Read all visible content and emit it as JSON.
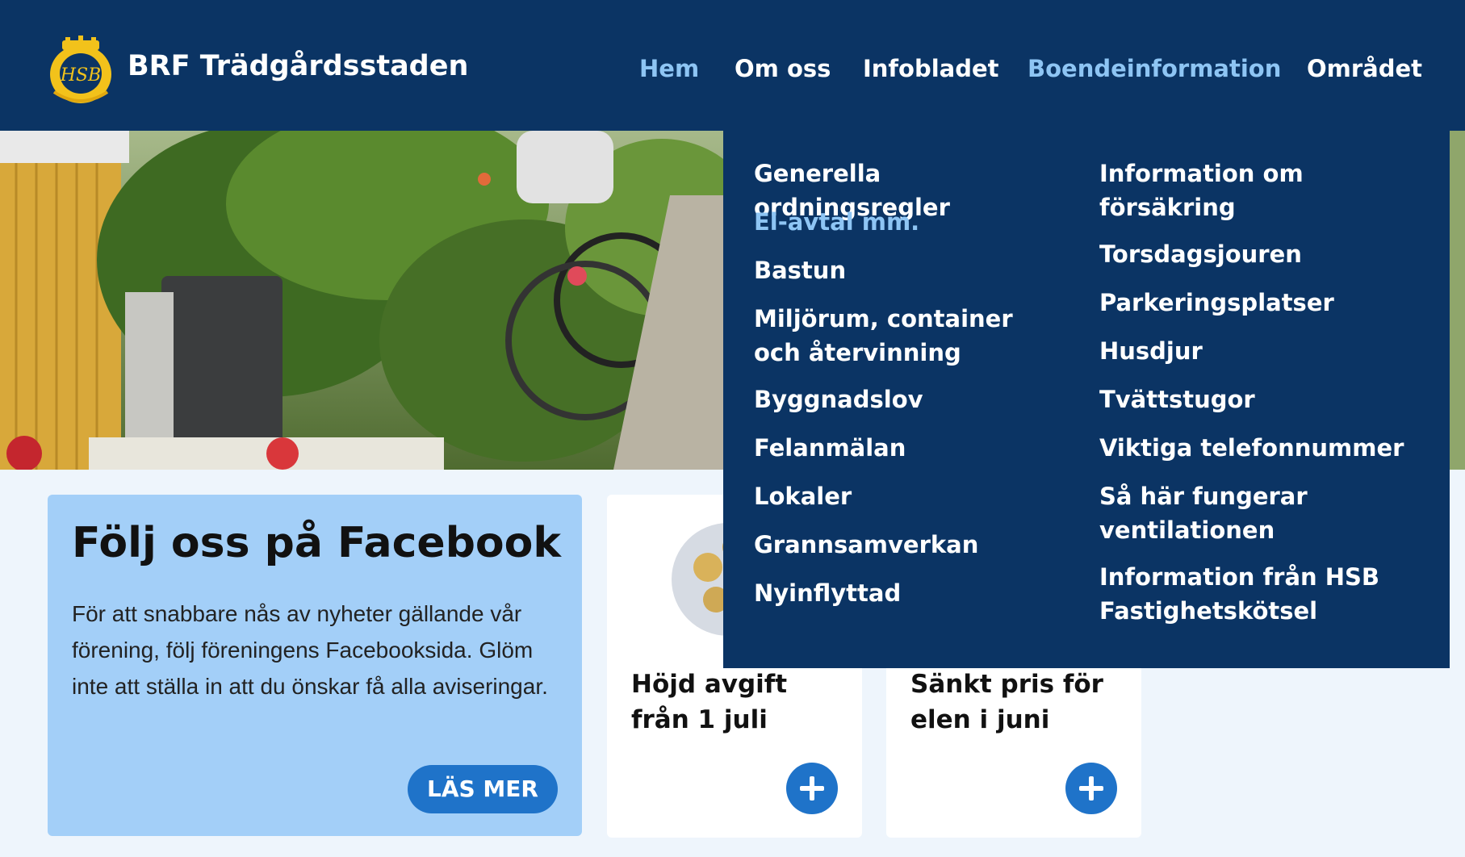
{
  "header": {
    "logo_text": "HSB",
    "site_title": "BRF Trädgårdsstaden",
    "nav": [
      {
        "label": "Hem",
        "active": true
      },
      {
        "label": "Om oss",
        "active": false
      },
      {
        "label": "Infobladet",
        "active": false
      },
      {
        "label": "Boendeinformation",
        "active": true
      },
      {
        "label": "Området",
        "active": false
      }
    ]
  },
  "dropdown": {
    "left_column": [
      {
        "label": "Generella ordningsregler",
        "active": false
      },
      {
        "label": "El-avtal mm.",
        "active": true
      },
      {
        "label": "Bastun",
        "active": false
      },
      {
        "label": "Miljörum, container och återvinning",
        "active": false
      },
      {
        "label": "Byggnadslov",
        "active": false
      },
      {
        "label": "Felanmälan",
        "active": false
      },
      {
        "label": "Lokaler",
        "active": false
      },
      {
        "label": "Grannsamverkan",
        "active": false
      },
      {
        "label": "Nyinflyttad",
        "active": false
      }
    ],
    "right_column": [
      {
        "label": "Information om försäkring"
      },
      {
        "label": "Torsdagsjouren"
      },
      {
        "label": "Parkeringsplatser"
      },
      {
        "label": "Husdjur"
      },
      {
        "label": "Tvättstugor"
      },
      {
        "label": "Viktiga telefonnummer"
      },
      {
        "label": "Så här fungerar ventilationen"
      },
      {
        "label": "Information från HSB Fastighetskötsel"
      }
    ]
  },
  "facebook_card": {
    "title": "Följ oss på Facebook",
    "text": "För att snabbare nås av nyheter gällande vår förening, följ föreningens Facebooksida. Glöm inte att ställa in att du önskar få alla aviseringar.",
    "button_label": "LÄS MER"
  },
  "news_cards": [
    {
      "title": "Höjd avgift från 1 juli"
    },
    {
      "title": "Sänkt pris för elen i juni"
    }
  ],
  "colors": {
    "header_bg": "#0b3464",
    "accent_light": "#8ec5f4",
    "button_blue": "#1f73c9",
    "card_blue": "#a3cff8"
  }
}
